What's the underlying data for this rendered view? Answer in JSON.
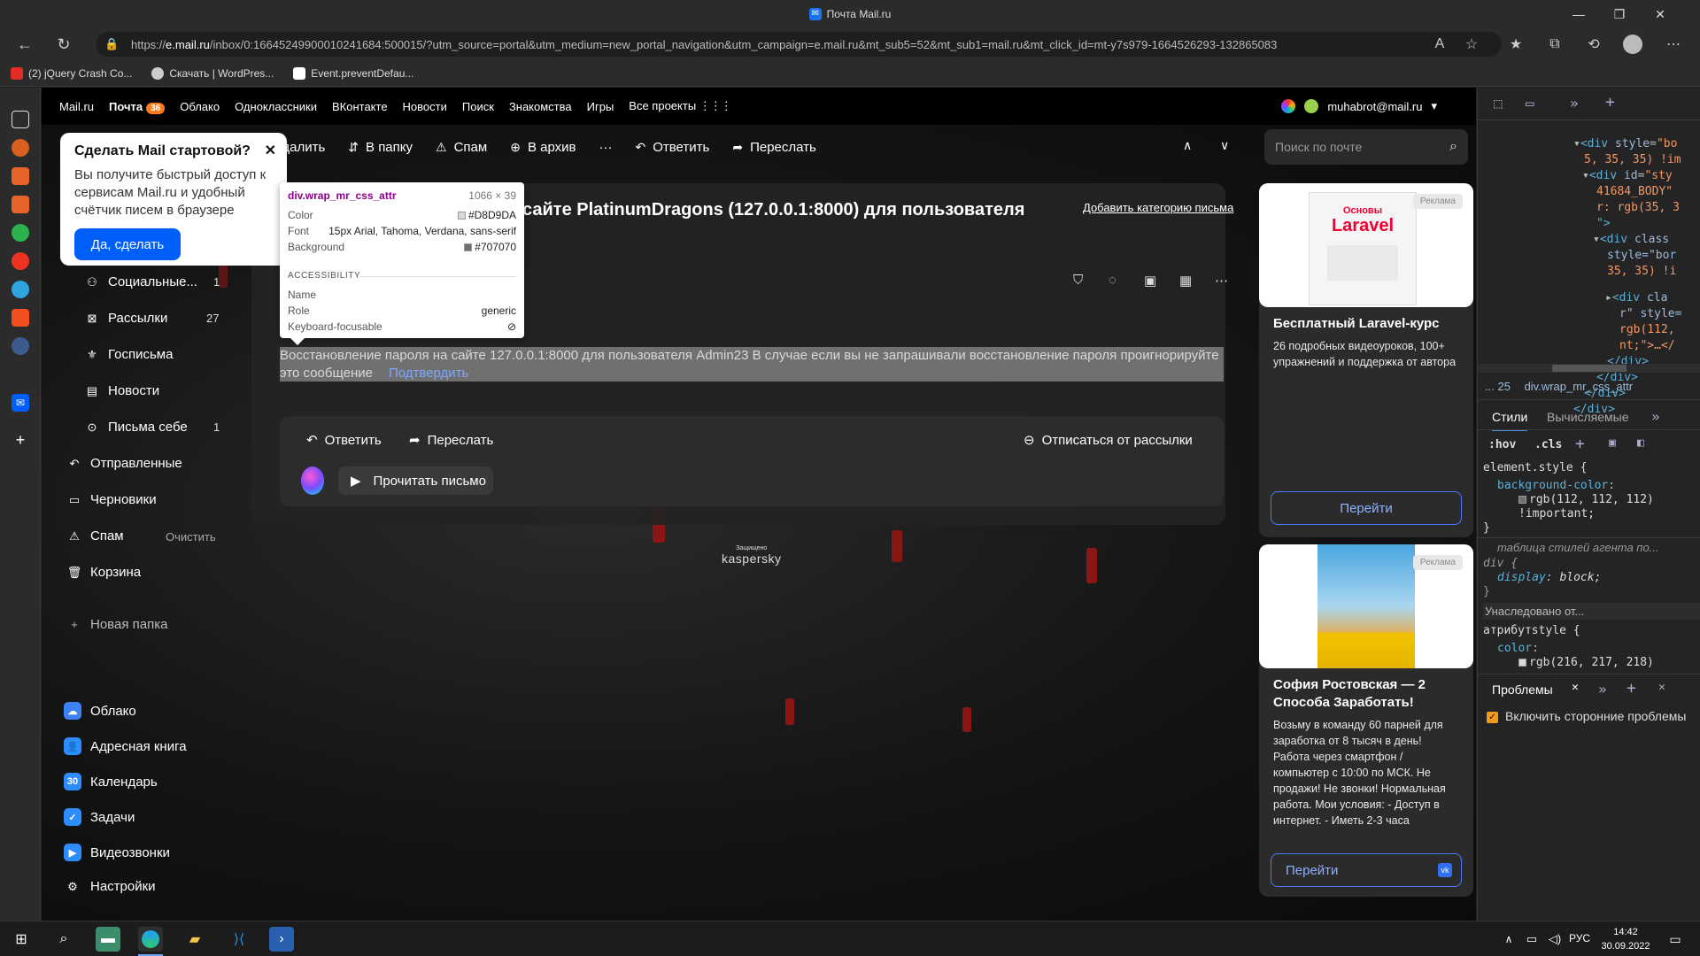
{
  "window": {
    "title": "Почта Mail.ru"
  },
  "browser": {
    "url_prefix": "https://",
    "url_host": "e.mail.ru",
    "url_rest": "/inbox/0:16645249900010241684:500015/?utm_source=portal&utm_medium=new_portal_navigation&utm_campaign=e.mail.ru&mt_sub5=52&mt_sub1=mail.ru&mt_click_id=mt-y7s979-1664526293-132865083",
    "bookmarks": [
      "(2) jQuery Crash Co...",
      "Скачать | WordPres...",
      "Event.preventDefau..."
    ]
  },
  "portal": {
    "items": [
      "Mail.ru",
      "Почта",
      "Облако",
      "Одноклассники",
      "ВКонтакте",
      "Новости",
      "Поиск",
      "Знакомства",
      "Игры",
      "Все проекты"
    ],
    "mail_badge": "36",
    "user": "muhabrot@mail.ru"
  },
  "toolbar": {
    "delete": "Удалить",
    "to_folder": "В папку",
    "spam": "Спам",
    "archive": "В архив",
    "more": "···",
    "reply": "Ответить",
    "forward": "Переслать"
  },
  "search": {
    "placeholder": "Поиск по почте"
  },
  "popup": {
    "title": "Сделать Mail стартовой?",
    "text": "Вы получите быстрый доступ к сервисам Mail.ru и удобный счётчик писем в браузере",
    "button": "Да, сделать"
  },
  "folders": [
    {
      "label": "Социальные...",
      "count": "1"
    },
    {
      "label": "Рассылки",
      "count": "27"
    },
    {
      "label": "Госписьма",
      "count": ""
    },
    {
      "label": "Новости",
      "count": ""
    },
    {
      "label": "Письма себе",
      "count": "1"
    },
    {
      "label": "Отправленные",
      "count": ""
    },
    {
      "label": "Черновики",
      "count": ""
    },
    {
      "label": "Спам",
      "count": "",
      "action": "Очистить"
    },
    {
      "label": "Корзина",
      "count": ""
    },
    {
      "label": "Новая папка",
      "count": ""
    }
  ],
  "apps": [
    "Облако",
    "Адресная книга",
    "Календарь",
    "Задачи",
    "Видеозвонки",
    "Настройки"
  ],
  "letter": {
    "subject": "сайте PlatinumDragons (127.0.0.1:8000) для пользователя",
    "add_category": "Добавить категорию письма",
    "body": "Восстановление пароля на сайте 127.0.0.1:8000 для пользователя Admin23 В случае если вы не запрашивали восстановление пароля проигнорируйте это сообщение",
    "link": "Подтвердить",
    "reply": "Ответить",
    "forward": "Переслать",
    "unsubscribe": "Отписаться от рассылки",
    "read_aloud": "Прочитать письмо",
    "protected_small": "Защищено",
    "protected_brand": "kaspersky"
  },
  "tooltip": {
    "selector": "div.wrap_mr_css_attr",
    "size": "1066 × 39",
    "color_label": "Color",
    "color_value": "#D8D9DA",
    "font_label": "Font",
    "font_value": "15px Arial, Tahoma, Verdana, sans-serif",
    "bg_label": "Background",
    "bg_value": "#707070",
    "accessibility": "ACCESSIBILITY",
    "name_label": "Name",
    "role_label": "Role",
    "role_value": "generic",
    "kbd_label": "Keyboard-focusable"
  },
  "ads": [
    {
      "tag": "Реклама",
      "image_caption_top": "Основы",
      "image_caption": "Laravel",
      "title": "Бесплатный Laravel-курс",
      "text": "26 подробных видеоуроков, 100+ упражнений и поддержка от автора",
      "button": "Перейти"
    },
    {
      "tag": "Реклама",
      "title": "София Ростовская — 2 Способа Заработать!",
      "text": "Возьму в команду 60 парней для заработка от 8 тысяч в день! Работа через смартфон / компьютер с 10:00 по МСК. Не продажи! Не звонки! Нормальная работа. Мои условия: - Доступ в интернет. - Иметь 2-3 часа",
      "button": "Перейти"
    }
  ],
  "devtools": {
    "breadcrumb_dots": "...",
    "breadcrumb_num": "25",
    "breadcrumb_sel": "div.wrap_mr_css_attr",
    "tabs": [
      "Стили",
      "Вычисляемые"
    ],
    "hov": ":hov",
    "cls": ".cls",
    "element_style": "element.style {",
    "bg_prop": "background-color",
    "bg_val": "rgb(112, 112, 112)",
    "important": "!important;",
    "close_brace": "}",
    "ua_comment": "таблица стилей агента по...",
    "div_rule": "div {",
    "display_prop": "display",
    "display_val": "block;",
    "inherited": "Унаследовано от...",
    "attr_style": "атрибутstyle {",
    "color_prop": "color",
    "color_val": "rgb(216, 217, 218)",
    "drawer_tab": "Проблемы",
    "checkbox_label": "Включить сторонние проблемы"
  },
  "taskbar": {
    "lang": "РУС",
    "time": "14:42",
    "date": "30.09.2022"
  }
}
